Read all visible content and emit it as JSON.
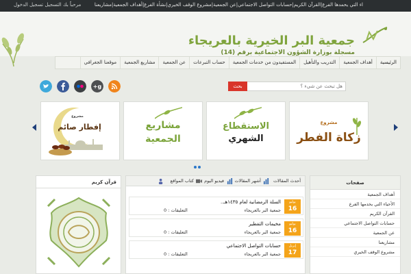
{
  "topbar": {
    "ticker": "اء التي يحمدها الفرع|القرآن الكريم|حسابات التواصل الاجتماعي|عن الجمعية|مشروع الوقف الخيري|نشأة الفرع|أهداف الجمعية|مشاريعنا",
    "auth": "مرحباً بك التسجيل تسجيل الدخول"
  },
  "header": {
    "title": "جمعية البر الخيرية بالعريجاء",
    "subtitle": "مسجلة بوزارة الشؤون الاجتماعية برقم (14)"
  },
  "nav": {
    "items": [
      "الرئيسية",
      "أهداف الجمعية",
      "التدريب والتأهيل",
      "المستفيدون من خدمات الجمعية",
      "حساب التبرعات",
      "عن الجمعية",
      "مشاريع الجمعية",
      "موقعنا الجغرافي"
    ]
  },
  "search": {
    "placeholder": "هل تبحث عن شيء ؟",
    "button": "بحث"
  },
  "social": [
    "facebook-icon",
    "twitter-icon",
    "flickr-icon",
    "googleplus-icon",
    "rss-icon"
  ],
  "slides": [
    {
      "line1": "مشروع",
      "line2": "زكاة الفطر"
    },
    {
      "line1": "الاستقطاع",
      "line2": "الشهري"
    },
    {
      "line1": "مشاريع",
      "line2": "الجمعية"
    },
    {
      "line1": "مشروع",
      "line2": "إفطار صائم"
    }
  ],
  "right_panel": {
    "heading": "صفحات",
    "items": [
      "أهداف الجمعية",
      "الأحياء التي يخدمها الفرع",
      "القرآن الكريم",
      "حسابات التواصل الاجتماعي",
      "عن الجمعية",
      "مشاريعنا",
      "مشروع الوقف الخيري"
    ]
  },
  "mid_panel": {
    "tabs": [
      "أحدث المقالات",
      "أشهر المقالات",
      "فيديو اليوم",
      "كتاب المواقع"
    ],
    "articles": [
      {
        "month": "يوليو",
        "day": "16",
        "title": "السلة الرمضانية لعام ١٤٣٥هـ..",
        "author": "جمعية البر بالعريجاء",
        "comments": "التعليقات : 0"
      },
      {
        "month": "يوليو",
        "day": "16",
        "title": "مخيمات التفطير",
        "author": "جمعية البر بالعريجاء",
        "comments": "التعليقات : 0"
      },
      {
        "month": "إبريل",
        "day": "17",
        "title": "حسابات التواصل الاجتماعي",
        "author": "جمعية البر بالعريجاء",
        "comments": "التعليقات : 0"
      }
    ]
  },
  "left_panel": {
    "heading": "قرآن كريم"
  }
}
